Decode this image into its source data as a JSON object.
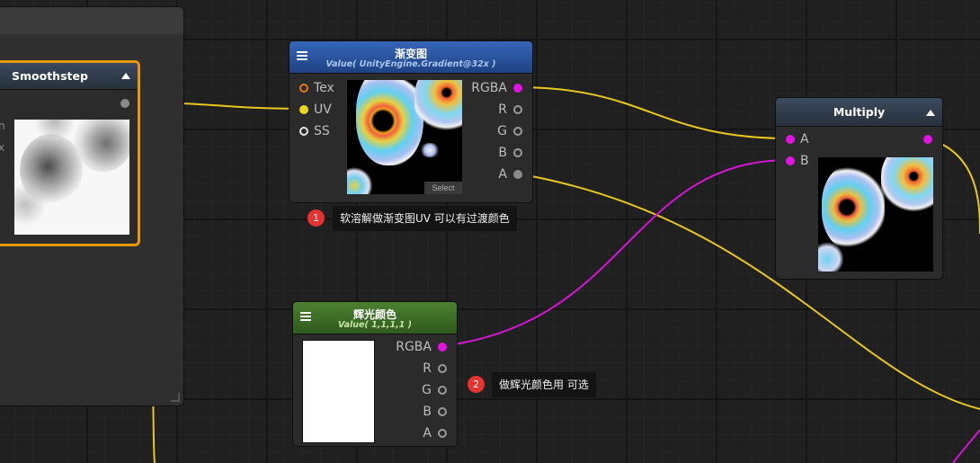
{
  "nodes": {
    "smoothstep": {
      "title": "Smoothstep",
      "left_hint_1": "n",
      "left_hint_2": "x"
    },
    "gradient": {
      "title": "渐变图",
      "subtitle": "Value( UnityEngine.Gradient@32x )",
      "inputs": [
        "Tex",
        "UV",
        "SS"
      ],
      "outputs": [
        "RGBA",
        "R",
        "G",
        "B",
        "A"
      ],
      "select_label": "Select"
    },
    "glow_color": {
      "title": "辉光颜色",
      "subtitle": "Value( 1,1,1,1 )",
      "outputs": [
        "RGBA",
        "R",
        "G",
        "B",
        "A"
      ]
    },
    "multiply": {
      "title": "Multiply",
      "inputs": [
        "A",
        "B"
      ]
    }
  },
  "notes": [
    {
      "number": "1",
      "text": "软溶解做渐变图UV 可以有过渡颜色"
    },
    {
      "number": "2",
      "text": "做辉光颜色用 可选"
    }
  ],
  "colors": {
    "wire_float": "#e8c81e",
    "wire_vector": "#d416d4",
    "selected_border": "#e8960c",
    "gradient_header": "#2a58a6",
    "color_header": "#3d6d27",
    "note_badge": "#e53430"
  }
}
